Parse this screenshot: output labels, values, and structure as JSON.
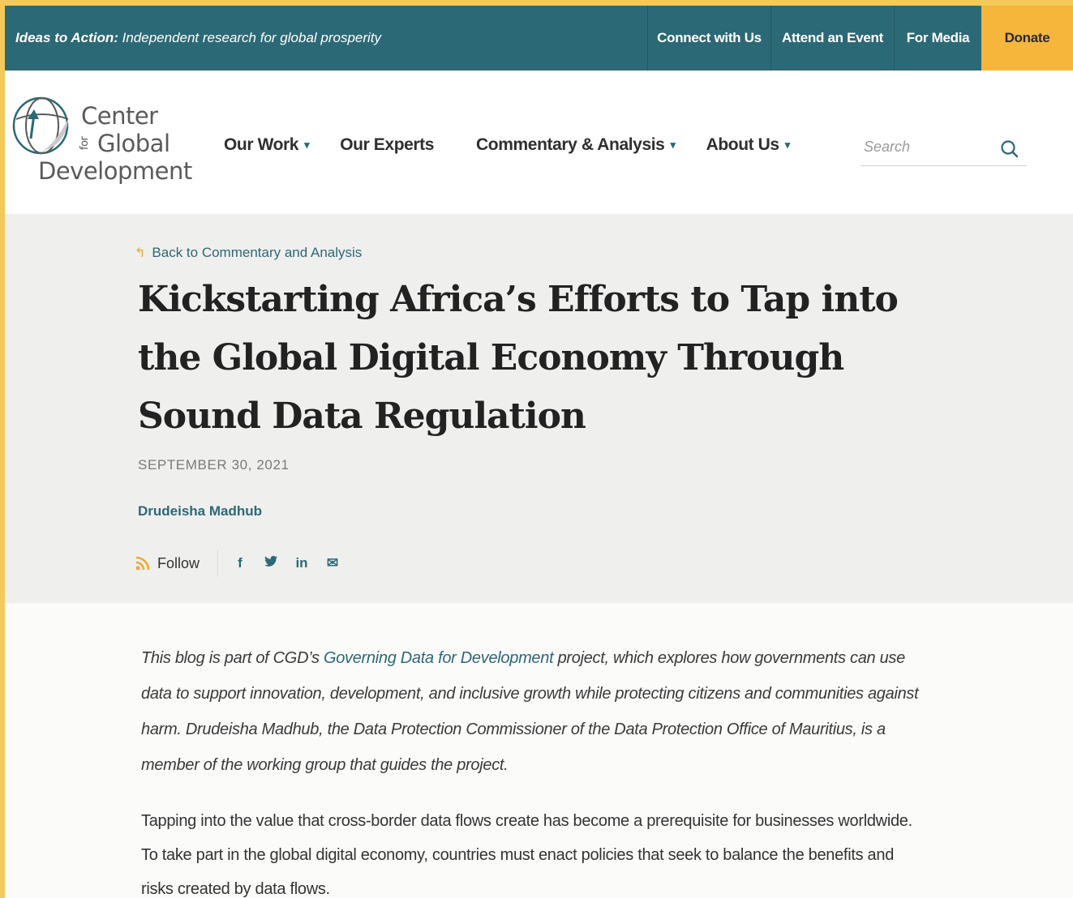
{
  "topbar": {
    "tagline_bold": "Ideas to Action:",
    "tagline_rest": " Independent research for global prosperity",
    "links": {
      "connect": "Connect with Us",
      "event": "Attend an Event",
      "media": "For Media",
      "donate": "Donate"
    }
  },
  "brand": {
    "line1": "Center",
    "for": "for",
    "line2": "Global",
    "line3": "Development"
  },
  "nav": {
    "our_work": "Our Work",
    "our_experts": "Our Experts",
    "commentary": "Commentary & Analysis",
    "about": "About Us",
    "caret": "▾"
  },
  "search": {
    "placeholder": "Search"
  },
  "article": {
    "back_link": "Back to Commentary and Analysis",
    "title": "Kickstarting Africa’s Efforts to Tap into the Global Digital Economy Through Sound Data Regulation",
    "date": "SEPTEMBER 30, 2021",
    "author": "Drudeisha Madhub",
    "follow": "Follow",
    "share": {
      "facebook": "f",
      "twitter": "🐦",
      "linkedin": "in",
      "email": "✉"
    }
  },
  "body": {
    "intro_before": "This blog is part of CGD’s ",
    "intro_link": "Governing Data for Development",
    "intro_after": " project, which explores how governments can use data to support innovation, development, and inclusive growth while protecting citizens and communities against harm. Drudeisha Madhub, the Data Protection Commissioner of the Data Protection Office of Mauritius, is a member of the working group that guides the project.",
    "paragraph1": "Tapping into the value that cross-border data flows create has become a prerequisite for businesses worldwide. To take part in the global digital economy, countries must enact policies that seek to balance the benefits and risks created by data flows."
  },
  "colors": {
    "teal": "#2c6976",
    "gold": "#f6b63c",
    "band": "#efefee"
  }
}
